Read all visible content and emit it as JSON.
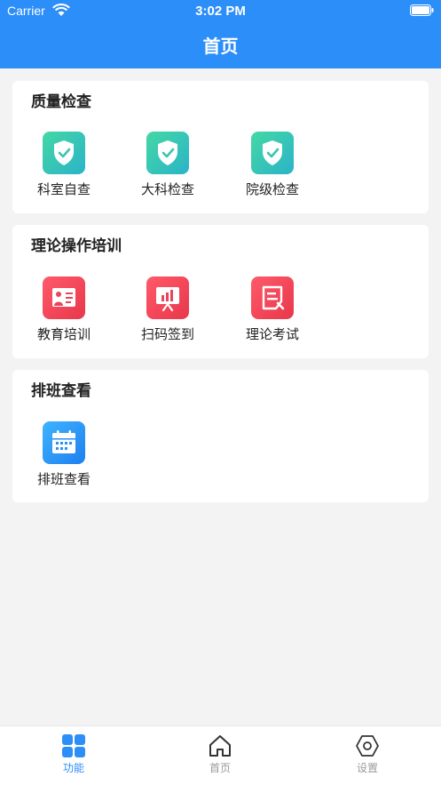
{
  "status_bar": {
    "carrier": "Carrier",
    "time": "3:02 PM"
  },
  "header": {
    "title": "首页"
  },
  "sections": [
    {
      "title": "质量检查",
      "items": [
        {
          "label": "科室自查",
          "icon": "shield-check-icon"
        },
        {
          "label": "大科检查",
          "icon": "shield-check-icon"
        },
        {
          "label": "院级检查",
          "icon": "shield-check-icon"
        }
      ]
    },
    {
      "title": "理论操作培训",
      "items": [
        {
          "label": "教育培训",
          "icon": "presenter-board-icon"
        },
        {
          "label": "扫码签到",
          "icon": "chart-board-icon"
        },
        {
          "label": "理论考试",
          "icon": "exam-paper-icon"
        }
      ]
    },
    {
      "title": "排班查看",
      "items": [
        {
          "label": "排班查看",
          "icon": "calendar-icon"
        }
      ]
    }
  ],
  "tabbar": {
    "items": [
      {
        "label": "功能",
        "icon": "grid-icon",
        "active": true
      },
      {
        "label": "首页",
        "icon": "home-icon",
        "active": false
      },
      {
        "label": "设置",
        "icon": "hexagon-gear-icon",
        "active": false
      }
    ]
  },
  "colors": {
    "primary": "#2c8ef8",
    "green_gradient": [
      "#44d8a4",
      "#2bb3c8"
    ],
    "red_gradient": [
      "#ff5a6a",
      "#e8374b"
    ],
    "blue_gradient": [
      "#3fb4ff",
      "#1e7ff0"
    ]
  }
}
